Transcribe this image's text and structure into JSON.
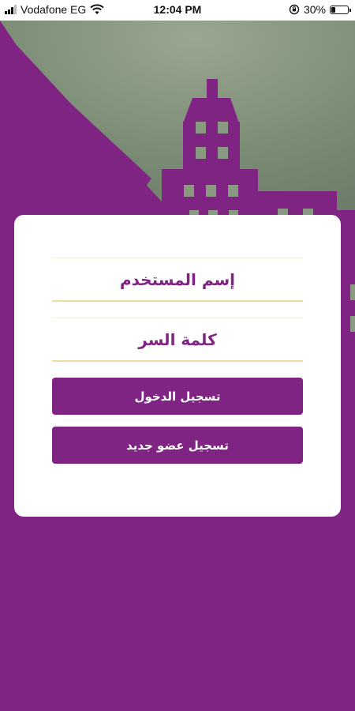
{
  "status_bar": {
    "carrier": "Vodafone EG",
    "time": "12:04 PM",
    "battery_percent": "30%",
    "battery_level": 0.3,
    "icons": [
      "signal-icon",
      "wifi-icon",
      "rotation-lock-icon",
      "battery-icon"
    ]
  },
  "login": {
    "username_placeholder": "إسم المستخدم",
    "password_placeholder": "كلمة السر",
    "login_button": "تسجيل الدخول",
    "register_button": "تسجيل عضو جديد"
  },
  "colors": {
    "primary": "#7f2482",
    "field_underline": "#f2d9a4",
    "sky": "#8a9a82",
    "card": "#ffffff"
  }
}
